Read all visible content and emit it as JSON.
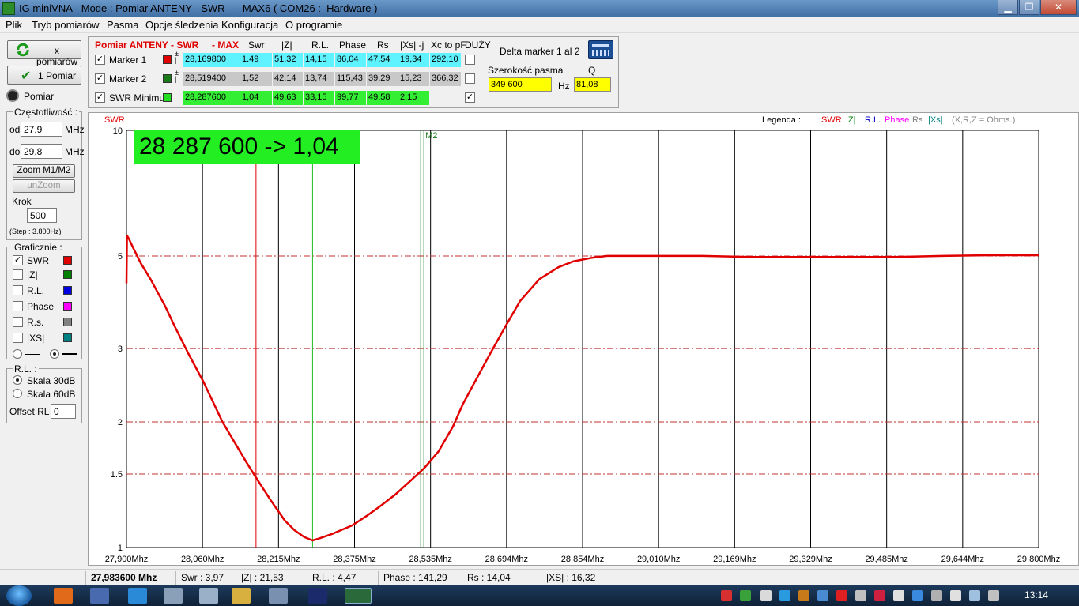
{
  "window": {
    "title": "IG miniVNA - Mode : Pomiar ANTENY - SWR    - MAX6 ( COM26 :  Hardware )",
    "minimize": "▁",
    "maximize": "❐",
    "close": "✕"
  },
  "menu": [
    "Plik",
    "Tryb pomiarów",
    "Pasma",
    "Opcje śledzenia",
    "Konfiguracja",
    "O programie"
  ],
  "left": {
    "multi_button": "x pomiarów",
    "single_button": "1 Pomiar",
    "pomiar_label": "Pomiar",
    "freq_group": "Częstotliwość :",
    "od_label": "od",
    "od_value": "27,9",
    "od_unit": "MHz",
    "do_label": "do",
    "do_value": "29,8",
    "do_unit": "MHz",
    "zoom_button": "Zoom M1/M2",
    "unzoom_button": "unZoom",
    "krok_label": "Krok",
    "krok_value": "500",
    "step_note": "(Step : 3.800Hz)",
    "graph_group": "Graficznie :",
    "graph_items": [
      {
        "label": "SWR",
        "checked": true,
        "color": "#e00000"
      },
      {
        "label": "|Z|",
        "checked": false,
        "color": "#008000"
      },
      {
        "label": "R.L.",
        "checked": false,
        "color": "#0000e0"
      },
      {
        "label": "Phase",
        "checked": false,
        "color": "#ff00ff"
      },
      {
        "label": "R.s.",
        "checked": false,
        "color": "#808080"
      },
      {
        "label": "|XS|",
        "checked": false,
        "color": "#008080"
      }
    ],
    "rl_group": "R.L. :",
    "rl_30": "Skala 30dB",
    "rl_60": "Skala 60dB",
    "offset_label": "Offset RL",
    "offset_value": "0"
  },
  "markers": {
    "mode_title": "Pomiar ANTENY - SWR",
    "mode_max": "- MAX",
    "headers": [
      "Swr",
      "|Z|",
      "R.L.",
      "Phase",
      "Rs",
      "|Xs| -j",
      "Xc to pF",
      "DUŻY"
    ],
    "rows": [
      {
        "label": "Marker 1",
        "checked": true,
        "color": "#e00000",
        "freq": "28,169800",
        "values": [
          "1.49",
          "51,32",
          "14,15",
          "86,04",
          "47,54",
          "19,34",
          "292,10"
        ],
        "bg": "#5ff3ff",
        "duzy": false
      },
      {
        "label": "Marker 2",
        "checked": true,
        "color": "#1a7a1a",
        "freq": "28,519400",
        "values": [
          "1,52",
          "42,14",
          "13,74",
          "115,43",
          "39,29",
          "15,23",
          "366,32"
        ],
        "bg": "#c8c8c8",
        "duzy": false
      },
      {
        "label": "SWR Minimu",
        "checked": true,
        "color": "#22dd22",
        "freq": "28,287600",
        "values": [
          "1,04",
          "49,63",
          "33,15",
          "99,77",
          "49,58",
          "2,15"
        ],
        "bg": "#33ee33",
        "duzy": true
      }
    ],
    "delta_title": "Delta marker 1 al 2",
    "bw_label": "Szerokość pasma",
    "bw_value": "349 600",
    "bw_unit": "Hz",
    "q_label": "Q",
    "q_value": "81,08"
  },
  "chart_data": {
    "type": "line",
    "ylabel": "SWR",
    "scale": "log",
    "ylim": [
      1,
      10
    ],
    "xlim": [
      27.9,
      29.8
    ],
    "y_ticks": [
      "10",
      "5",
      "3",
      "2",
      "1.5",
      "1"
    ],
    "y_tick_values": [
      10,
      5,
      3,
      2,
      1.5,
      1
    ],
    "x_ticks": [
      "27,900Mhz",
      "28,060Mhz",
      "28,215Mhz",
      "28,375Mhz",
      "28,535Mhz",
      "28,694Mhz",
      "28,854Mhz",
      "29,010Mhz",
      "29,169Mhz",
      "29,329Mhz",
      "29,485Mhz",
      "29,644Mhz",
      "29,800Mhz"
    ],
    "banner": "28 287 600 -> 1,04",
    "legend_title": "Legenda :",
    "legend_items": [
      {
        "label": "SWR",
        "color": "#e00000"
      },
      {
        "label": "|Z|",
        "color": "#008000"
      },
      {
        "label": "R.L.",
        "color": "#0000c0"
      },
      {
        "label": "Phase",
        "color": "#ff00ff"
      },
      {
        "label": "Rs",
        "color": "#808080"
      },
      {
        "label": "|Xs|",
        "color": "#008080"
      },
      {
        "label": "(X,R,Z = Ohms.)",
        "color": "#888888"
      }
    ],
    "markers": [
      {
        "label": "M1",
        "x": 28.1698,
        "color": "#e00000"
      },
      {
        "label": "M2",
        "x": 28.5194,
        "color": "#1a7a1a"
      },
      {
        "label": "Min",
        "x": 28.2876,
        "color": "#22bb22"
      }
    ],
    "series": [
      {
        "name": "SWR",
        "color": "#e00000",
        "x": [
          27.9,
          27.901,
          27.905,
          27.915,
          27.93,
          27.95,
          27.98,
          28.0,
          28.03,
          28.06,
          28.1,
          28.15,
          28.17,
          28.2,
          28.23,
          28.25,
          28.27,
          28.2876,
          28.3,
          28.33,
          28.37,
          28.4,
          28.43,
          28.46,
          28.49,
          28.52,
          28.55,
          28.58,
          28.6,
          28.63,
          28.66,
          28.69,
          28.72,
          28.76,
          28.8,
          28.83,
          28.87,
          28.9,
          29.0,
          29.1,
          29.2,
          29.3,
          29.4,
          29.5,
          29.6,
          29.7,
          29.8
        ],
        "y": [
          4.3,
          5.6,
          5.5,
          5.2,
          4.8,
          4.4,
          3.8,
          3.4,
          2.9,
          2.5,
          2.0,
          1.6,
          1.47,
          1.3,
          1.16,
          1.1,
          1.06,
          1.04,
          1.05,
          1.08,
          1.13,
          1.19,
          1.26,
          1.34,
          1.44,
          1.55,
          1.7,
          1.95,
          2.2,
          2.55,
          2.95,
          3.4,
          3.9,
          4.4,
          4.7,
          4.85,
          4.95,
          5.0,
          5.0,
          5.0,
          4.97,
          4.97,
          4.97,
          4.97,
          5.0,
          5.02,
          5.02
        ]
      }
    ]
  },
  "status": [
    "27,983600 Mhz",
    "Swr : 3,97",
    "|Z| : 21,53",
    "R.L. : 4,47",
    "Phase : 141,29",
    "Rs : 14,04",
    "|XS| : 16,32"
  ],
  "taskbar": {
    "clock": "13:14"
  }
}
